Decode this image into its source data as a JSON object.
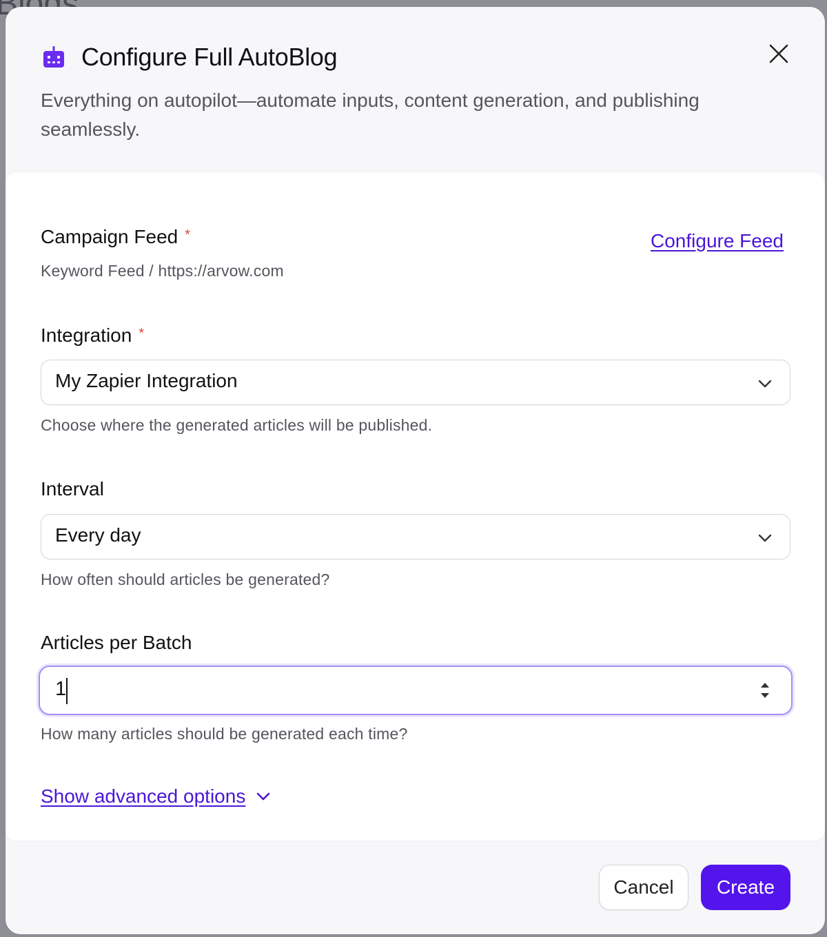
{
  "backdrop": {
    "text": "Blogs"
  },
  "dialog": {
    "title": "Configure Full AutoBlog",
    "subtitle": "Everything on autopilot—automate inputs, content generation, and publishing seamlessly.",
    "icons": {
      "title_icon": "robot-icon",
      "close": "close-icon"
    }
  },
  "campaign_feed": {
    "label": "Campaign Feed",
    "required_mark": "*",
    "value": "Keyword Feed / https://arvow.com",
    "configure_link": "Configure Feed"
  },
  "integration": {
    "label": "Integration",
    "required_mark": "*",
    "selected": "My Zapier Integration",
    "help": "Choose where the generated articles will be published."
  },
  "interval": {
    "label": "Interval",
    "selected": "Every day",
    "help": "How often should articles be generated?"
  },
  "articles_per_batch": {
    "label": "Articles per Batch",
    "value": "1",
    "help": "How many articles should be generated each time?"
  },
  "advanced": {
    "label": "Show advanced options"
  },
  "footer": {
    "cancel_label": "Cancel",
    "create_label": "Create"
  },
  "colors": {
    "accent": "#5315ec",
    "link": "#4a16d8",
    "required": "#e0453b",
    "focus_border": "#a58ef5",
    "icon_purple": "#6a2cf0"
  }
}
